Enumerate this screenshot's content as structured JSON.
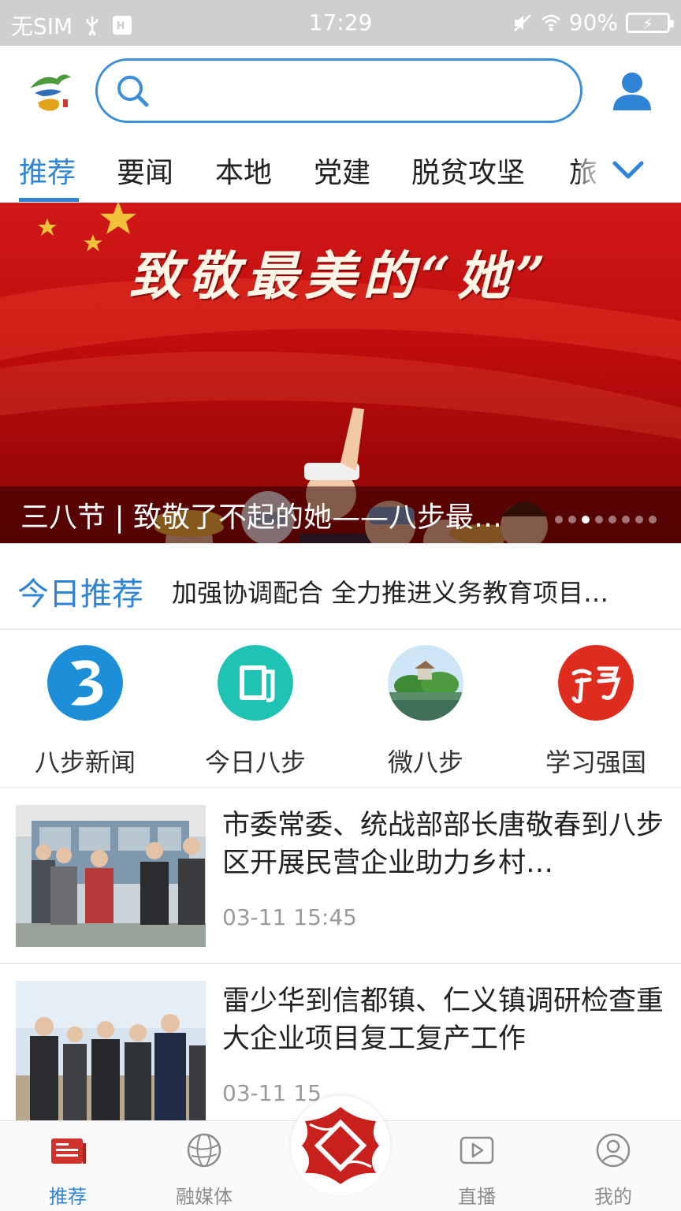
{
  "status_bar": {
    "carrier": "无SIM",
    "time": "17:29",
    "battery": "90%"
  },
  "header": {
    "logo_icon": "app-logo-icon",
    "search_placeholder": "",
    "user_icon": "user-icon"
  },
  "tabs": {
    "items": [
      "推荐",
      "要闻",
      "本地",
      "党建",
      "脱贫攻坚",
      "旅"
    ],
    "active": "推荐",
    "more_icon": "chevron-down-icon"
  },
  "banner": {
    "heading": "致敬最美的“她”",
    "caption": "三八节 | 致敬了不起的她——八步最…",
    "page_count": 8,
    "active_page": 3
  },
  "today": {
    "label": "今日推荐",
    "headline": "加强协调配合 全力推进义务教育项目…"
  },
  "quick_links": [
    {
      "label": "八步新闻",
      "icon": "bbu-news-icon"
    },
    {
      "label": "今日八步",
      "icon": "newspaper-icon"
    },
    {
      "label": "微八步",
      "icon": "landscape-icon"
    },
    {
      "label": "学习强国",
      "icon": "xuexi-icon"
    }
  ],
  "news": [
    {
      "title": "市委常委、统战部部长唐敬春到八步区开展民营企业助力乡村…",
      "time": "03-11 15:45"
    },
    {
      "title": "雷少华到信都镇、仁义镇调研检查重大企业项目复工复产工作",
      "time": "03-11 15"
    }
  ],
  "bottom_nav": [
    {
      "label": "推荐",
      "icon": "news-icon",
      "active": true
    },
    {
      "label": "融媒体",
      "icon": "globe-icon",
      "active": false
    },
    {
      "label": "",
      "icon": "center-logo-icon",
      "active": false
    },
    {
      "label": "直播",
      "icon": "play-icon",
      "active": false
    },
    {
      "label": "我的",
      "icon": "profile-icon",
      "active": false
    }
  ],
  "colors": {
    "accent": "#2f84d6",
    "banner_red": "#c10d0d",
    "center_red": "#c8201d"
  }
}
